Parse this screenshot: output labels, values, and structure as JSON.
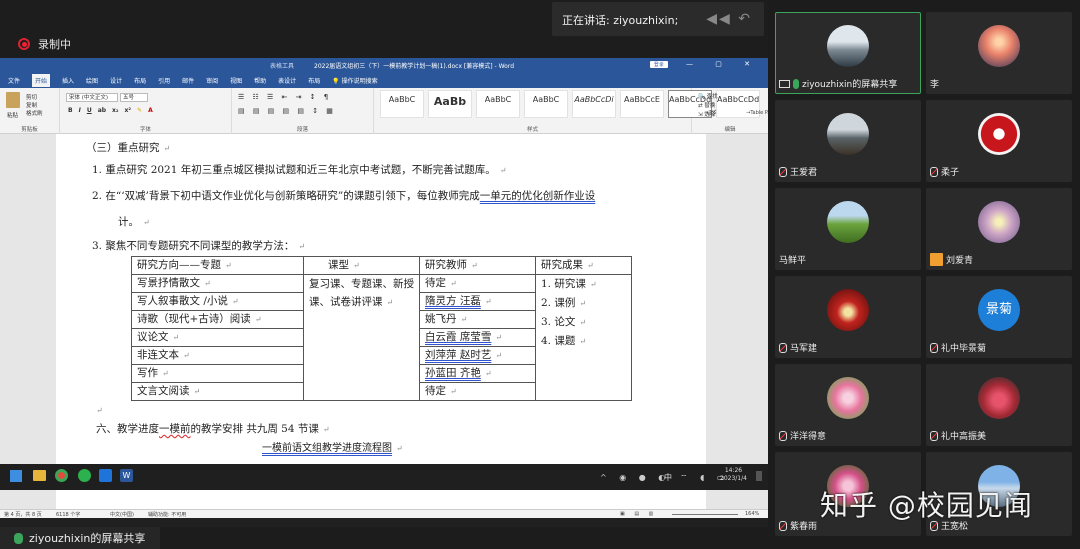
{
  "meeting": {
    "recording_label": "录制中",
    "speaking_label": "正在讲话: ziyouzhixin;",
    "share_banner": "ziyouzhixin的屏幕共享"
  },
  "word": {
    "title": "2022届语文组初三（下）一模前教学计划一稿(1).docx [兼容模式] - Word",
    "table_tools": "表格工具",
    "login": "登录",
    "menu": [
      "文件",
      "开始",
      "插入",
      "绘图",
      "设计",
      "布局",
      "引用",
      "邮件",
      "审阅",
      "视图",
      "帮助",
      "表设计",
      "布局",
      "操作说明搜索"
    ],
    "ribbon": {
      "paste": "粘贴",
      "cut": "剪切",
      "copy": "复制",
      "format_painter": "格式刷",
      "clipboard": "剪贴板",
      "font_name": "宋体 (中文正文)",
      "font_size": "五号",
      "font_group": "字体",
      "paragraph_group": "段落",
      "styles_group": "样式",
      "editing_group": "编辑",
      "find": "查找",
      "replace": "替换",
      "select": "选择",
      "styles": [
        {
          "preview": "AaBbC",
          "label": "标题"
        },
        {
          "preview": "AaBb",
          "label": "标题 1"
        },
        {
          "preview": "AaBbC",
          "label": "标题 2"
        },
        {
          "preview": "AaBbC",
          "label": "标题 3"
        },
        {
          "preview": "AaBbCcDi",
          "label": "强调"
        },
        {
          "preview": "AaBbCcE",
          "label": "要点"
        },
        {
          "preview": "AaBbCcDd",
          "label": "→正文"
        },
        {
          "preview": "AaBbCcDd",
          "label": "→Table P..."
        }
      ]
    },
    "doc": {
      "heading3": "（三）重点研究",
      "item1": "1. 重点研究 2021 年初三重点城区模拟试题和近三年北京中考试题，不断完善试题库。",
      "item2a": "2. 在“‘双减’背景下初中语文作业优化与创新策略研究”的课题引领下，每位教师完成",
      "item2b": "一单元的优化创新作业设",
      "item2c": "计。",
      "item3": "3. 聚焦不同专题研究不同课型的教学方法：",
      "table": {
        "headers": [
          "研究方向——专题",
          "课型",
          "研究教师",
          "研究成果"
        ],
        "topics": [
          "写景抒情散文",
          "写人叙事散文 /小说",
          "诗歌（现代+古诗）阅读",
          "议论文",
          "非连文本",
          "写作",
          "文言文阅读"
        ],
        "course_types": "复习课、专题课、新授课、试卷讲评课",
        "teachers": [
          "待定",
          "隋灵方  汪磊",
          "姚飞丹",
          "白云霞  席莹雪",
          "刘萍萍  赵时艺",
          "孙蓝田  齐艳",
          "待定"
        ],
        "results": [
          "1. 研究课",
          "2. 课例",
          "3. 论文",
          "4. 课题"
        ]
      },
      "section6a": "六、教学进度",
      "section6b": "一模前",
      "section6c": "的教学安排    共九周      54 节课",
      "flow_title": "一模前语文组教学进度流程图"
    },
    "status": {
      "page": "第 4 页，共 8 页",
      "words": "6118 个字",
      "lang": "中文(中国)",
      "accessibility": "辅助功能: 不可用",
      "zoom": "164%"
    },
    "clock": {
      "time": "14:26",
      "date": "2023/1/4"
    },
    "tray_lang": "中"
  },
  "participants": [
    {
      "name": "ziyouzhixin的屏幕共享",
      "active": true
    },
    {
      "name": "李"
    },
    {
      "name": "王爱君"
    },
    {
      "name": "柔子"
    },
    {
      "name": "马鲜平"
    },
    {
      "name": "刘爱青"
    },
    {
      "name": "马军建"
    },
    {
      "name": "礼中毕景菊",
      "avatar_text": "景菊"
    },
    {
      "name": "洋洋得意"
    },
    {
      "name": "礼中高振美"
    },
    {
      "name": "紫春雨"
    },
    {
      "name": "王宽松"
    }
  ],
  "watermark": "知乎 @校园见闻",
  "colors": {
    "word_blue": "#2b579a",
    "active_border": "#3ba55c",
    "avatar_blue": "#1e7fd8"
  }
}
